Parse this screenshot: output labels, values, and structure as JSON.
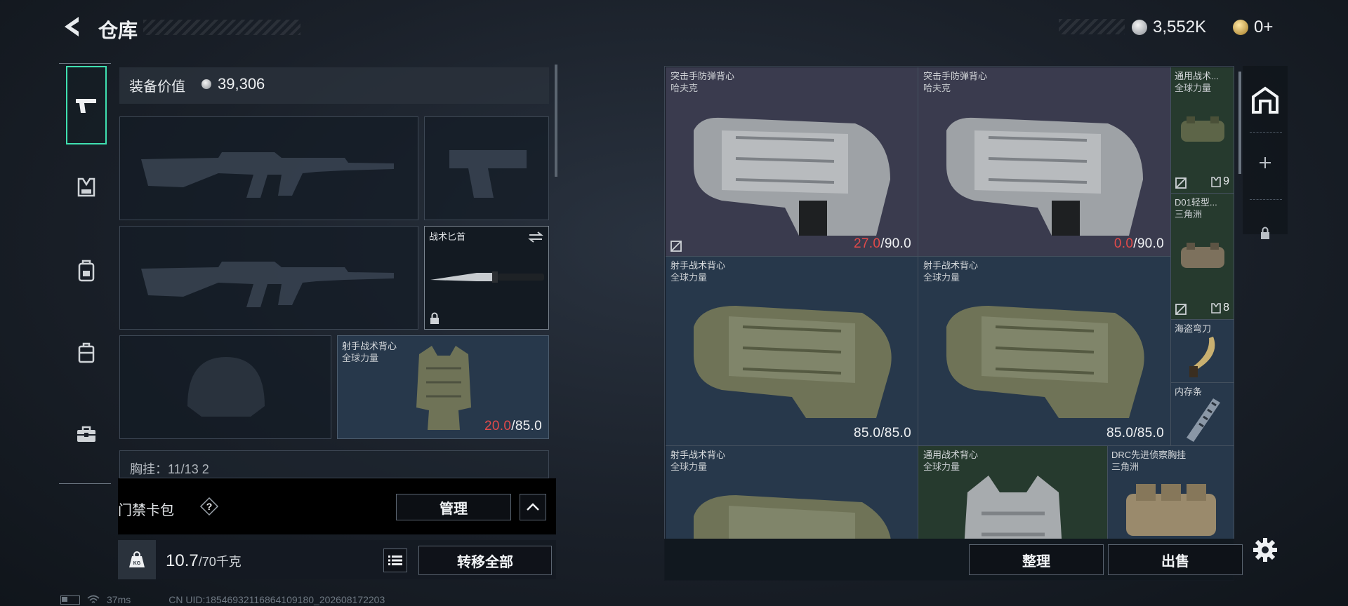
{
  "header": {
    "title": "仓库",
    "currency_amount": "3,552K",
    "secondary_amount": "0+"
  },
  "sidebar": {
    "items": [
      "weapon-icon",
      "vest-icon",
      "backpack-icon",
      "bag-icon",
      "toolbox-icon"
    ]
  },
  "loadout": {
    "equipment_value_label": "装备价值",
    "equipment_value": "39,306",
    "melee": {
      "name": "战术匕首"
    },
    "armor": {
      "name": "射手战术背心",
      "brand": "全球力量",
      "durability_current": "20.0",
      "durability_max": "/85.0"
    },
    "chest_rig_partial": "胸挂：11/13  2",
    "keycard_label": "门禁卡包",
    "manage_label": "管理",
    "weight_current": "10.7",
    "weight_max": "/70千克",
    "transfer_all_label": "转移全部"
  },
  "storage": {
    "items": [
      {
        "name": "突击手防弹背心",
        "brand": "哈夫克",
        "durability_current": "27.0",
        "durability_max": "/90.0"
      },
      {
        "name": "突击手防弹背心",
        "brand": "哈夫克",
        "durability_current": "0.0",
        "durability_max": "/90.0"
      },
      {
        "name": "通用战术...",
        "brand": "全球力量",
        "count": "9"
      },
      {
        "name": "D01轻型...",
        "brand": "三角洲",
        "count": "8"
      },
      {
        "name": "射手战术背心",
        "brand": "全球力量",
        "durability": "85.0/85.0"
      },
      {
        "name": "射手战术背心",
        "brand": "全球力量",
        "durability": "85.0/85.0"
      },
      {
        "name": "海盗弯刀"
      },
      {
        "name": "内存条"
      },
      {
        "name": "射手战术背心",
        "brand": "全球力量"
      },
      {
        "name": "通用战术背心",
        "brand": "全球力量"
      },
      {
        "name": "DRC先进侦察胸挂",
        "brand": "三角洲"
      }
    ],
    "sort_label": "整理",
    "sell_label": "出售"
  },
  "status": {
    "ping": "37ms",
    "uid": "CN UID:18546932116864109180_202608172203"
  },
  "colors": {
    "accent": "#3fe0b0",
    "warning": "#e24a4a",
    "panel": "#1a222c"
  }
}
